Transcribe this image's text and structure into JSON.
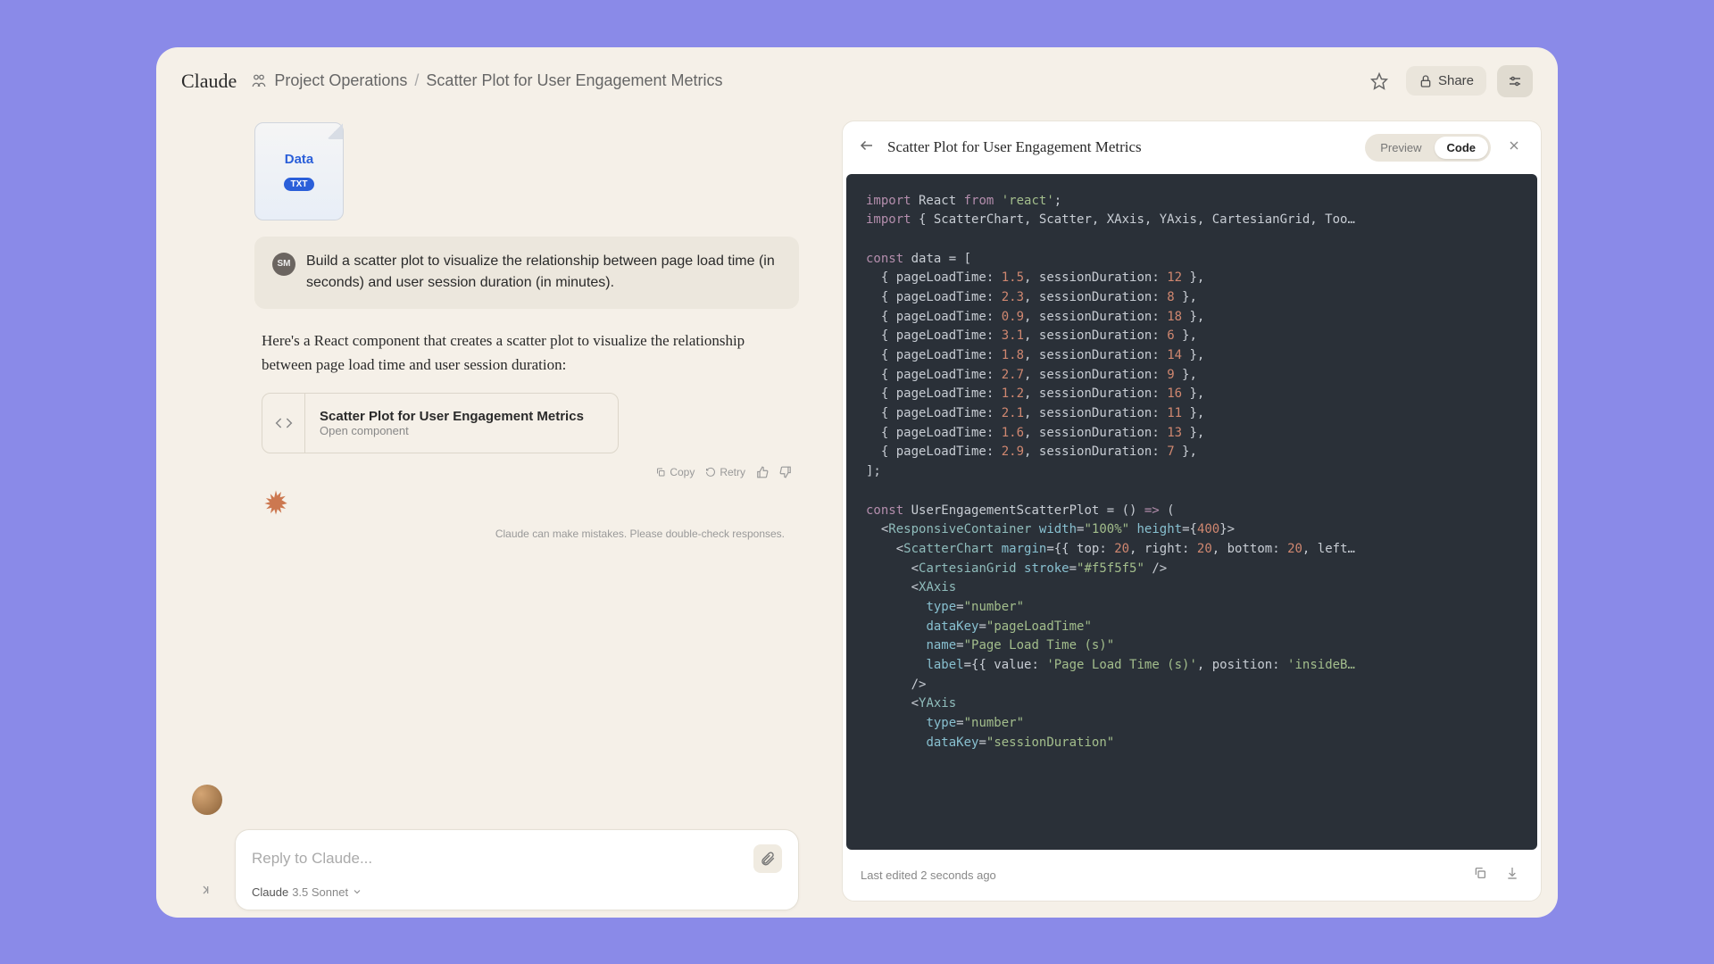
{
  "header": {
    "logo": "Claude",
    "breadcrumb_project": "Project Operations",
    "breadcrumb_current": "Scatter Plot for User Engagement Metrics",
    "share_label": "Share"
  },
  "chat": {
    "file": {
      "name": "Data",
      "ext": "TXT"
    },
    "user_initials": "SM",
    "user_message": "Build a scatter plot to visualize the relationship between page load time (in seconds) and user session duration (in minutes).",
    "assistant_message": "Here's a React component that creates a scatter plot to visualize the relationship between page load time and user session duration:",
    "artifact": {
      "title": "Scatter Plot for User Engagement Metrics",
      "subtitle": "Open component"
    },
    "actions": {
      "copy": "Copy",
      "retry": "Retry"
    },
    "disclaimer": "Claude can make mistakes. Please double-check responses."
  },
  "input": {
    "placeholder": "Reply to Claude...",
    "model_name": "Claude",
    "model_version": "3.5 Sonnet"
  },
  "panel": {
    "title": "Scatter Plot for User Engagement Metrics",
    "toggle": {
      "preview": "Preview",
      "code": "Code"
    },
    "footer": "Last edited 2 seconds ago"
  },
  "code": {
    "data_points": [
      {
        "pageLoadTime": 1.5,
        "sessionDuration": 12
      },
      {
        "pageLoadTime": 2.3,
        "sessionDuration": 8
      },
      {
        "pageLoadTime": 0.9,
        "sessionDuration": 18
      },
      {
        "pageLoadTime": 3.1,
        "sessionDuration": 6
      },
      {
        "pageLoadTime": 1.8,
        "sessionDuration": 14
      },
      {
        "pageLoadTime": 2.7,
        "sessionDuration": 9
      },
      {
        "pageLoadTime": 1.2,
        "sessionDuration": 16
      },
      {
        "pageLoadTime": 2.1,
        "sessionDuration": 11
      },
      {
        "pageLoadTime": 1.6,
        "sessionDuration": 13
      },
      {
        "pageLoadTime": 2.9,
        "sessionDuration": 7
      }
    ]
  }
}
